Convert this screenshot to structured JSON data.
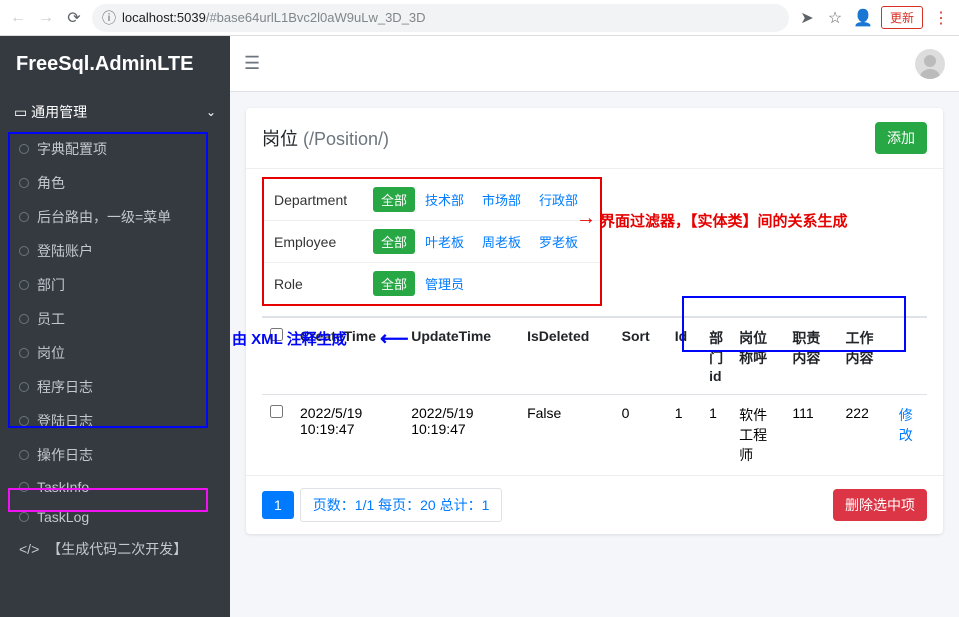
{
  "browser": {
    "url_host": "localhost:5039",
    "url_path": "/#base64urlL1Bvc2l0aW9uLw_3D_3D",
    "update": "更新"
  },
  "brand": "FreeSql.AdminLTE",
  "sidebar": {
    "header": "通用管理",
    "items": [
      "字典配置项",
      "角色",
      "后台路由，一级=菜单",
      "登陆账户",
      "部门",
      "员工",
      "岗位",
      "程序日志",
      "登陆日志",
      "操作日志",
      "TaskInfo",
      "TaskLog"
    ],
    "codegen": "【生成代码二次开发】"
  },
  "page": {
    "title": "岗位",
    "subtitle": "(/Position/)",
    "add_btn": "添加",
    "delete_btn": "删除选中项"
  },
  "filters": [
    {
      "label": "Department",
      "active": "全部",
      "options": [
        "技术部",
        "市场部",
        "行政部"
      ]
    },
    {
      "label": "Employee",
      "active": "全部",
      "options": [
        "叶老板",
        "周老板",
        "罗老板"
      ]
    },
    {
      "label": "Role",
      "active": "全部",
      "options": [
        "管理员"
      ]
    }
  ],
  "columns": [
    "CreateTime",
    "UpdateTime",
    "IsDeleted",
    "Sort",
    "Id",
    "部门id",
    "岗位称呼",
    "职责内容",
    "工作内容",
    ""
  ],
  "rows": [
    {
      "CreateTime": "2022/5/19 10:19:47",
      "UpdateTime": "2022/5/19 10:19:47",
      "IsDeleted": "False",
      "Sort": "0",
      "Id": "1",
      "dept": "1",
      "name": "软件工程师",
      "duty": "111",
      "work": "222",
      "action": "修改"
    }
  ],
  "pager": {
    "current": "1",
    "info": "页数：1/1 每页：20 总计：1"
  },
  "annot": {
    "red": "界面过滤器，【实体类】间的关系生成",
    "blue": "由 XML 注释生成"
  }
}
